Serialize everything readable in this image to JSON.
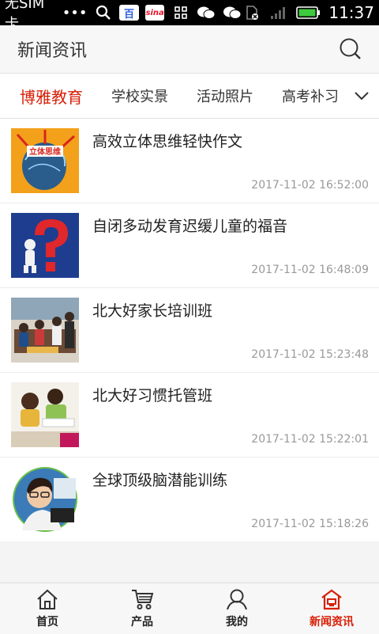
{
  "status_bar": {
    "carrier": "无SIM卡",
    "dots": "•••",
    "baidu_badge": "百",
    "sina_badge": "sina",
    "time": "11:37"
  },
  "app_bar": {
    "title": "新闻资讯"
  },
  "category_tabs": [
    {
      "label": "博雅教育",
      "active": true
    },
    {
      "label": "学校实景",
      "active": false
    },
    {
      "label": "活动照片",
      "active": false
    },
    {
      "label": "高考补习",
      "active": false
    }
  ],
  "news": [
    {
      "title": "高效立体思维轻快作文",
      "date": "2017-11-02 16:52:00",
      "thumb_text": "立体思维"
    },
    {
      "title": "自闭多动发育迟缓儿童的福音",
      "date": "2017-11-02 16:48:09"
    },
    {
      "title": "北大好家长培训班",
      "date": "2017-11-02 15:23:48"
    },
    {
      "title": "北大好习惯托管班",
      "date": "2017-11-02 15:22:01"
    },
    {
      "title": "全球顶级脑潜能训练",
      "date": "2017-11-02 15:18:26"
    }
  ],
  "bottom_nav": [
    {
      "label": "首页",
      "icon": "home-icon",
      "active": false
    },
    {
      "label": "产品",
      "icon": "cart-icon",
      "active": false
    },
    {
      "label": "我的",
      "icon": "user-icon",
      "active": false
    },
    {
      "label": "新闻资讯",
      "icon": "news-house-icon",
      "active": true
    }
  ],
  "colors": {
    "accent": "#d81e06",
    "text": "#222222",
    "muted": "#999999"
  }
}
